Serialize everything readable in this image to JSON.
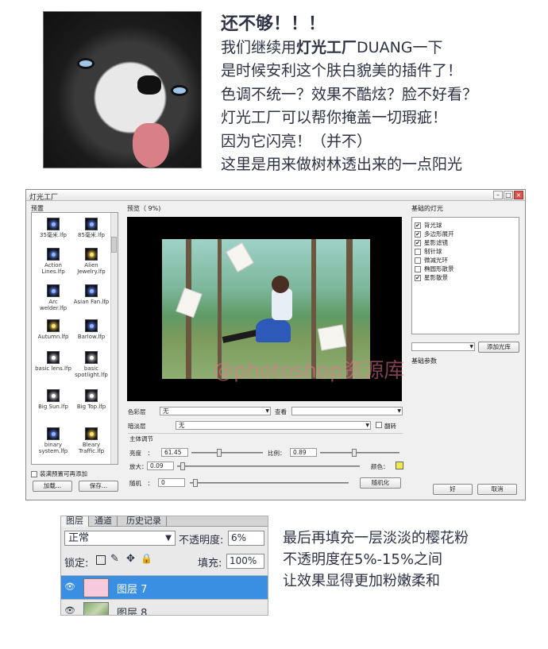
{
  "intro": {
    "title": "还不够！！！",
    "line1_prefix": "我们继续用",
    "line1_bold": "灯光工厂",
    "line1_suffix": "DUANG一下",
    "line2": "是时候安利这个肤白貌美的插件了！",
    "line3": "色调不统一？效果不酷炫？脸不好看？",
    "line4": "灯光工厂可以帮你掩盖一切瑕疵！",
    "line5": "因为它闪亮！（并不）",
    "line6": "这里是用来做树林透出来的一点阳光"
  },
  "dialog": {
    "window_title": "灯光工厂",
    "presets_label": "预置",
    "preview_label": "预览（ 9%)",
    "lights_label": "基础的灯光",
    "presets": [
      {
        "label": "35毫米.lfp",
        "icon": "lens-flare-icon"
      },
      {
        "label": "85毫米.lfp",
        "icon": "lens-flare-icon"
      },
      {
        "label": "Action Lines.lfp",
        "icon": "lens-flare-icon"
      },
      {
        "label": "Alien Jewelry.lfp",
        "icon": "lens-flare-icon"
      },
      {
        "label": "Arc welder.lfp",
        "icon": "lens-flare-icon"
      },
      {
        "label": "Asian Fan.lfp",
        "icon": "lens-flare-icon"
      },
      {
        "label": "Autumn.lfp",
        "icon": "lens-flare-icon"
      },
      {
        "label": "Barlow.lfp",
        "icon": "lens-flare-icon"
      },
      {
        "label": "basic lens.lfp",
        "icon": "lens-flare-icon"
      },
      {
        "label": "basic spotlight.lfp",
        "icon": "lens-flare-icon"
      },
      {
        "label": "Big Sun.lfp",
        "icon": "lens-flare-icon"
      },
      {
        "label": "Big Top.lfp",
        "icon": "lens-flare-icon"
      },
      {
        "label": "binary system.lfp",
        "icon": "lens-flare-icon"
      },
      {
        "label": "Bleary Traffic.lfp",
        "icon": "lens-flare-icon"
      }
    ],
    "auto_add_label": "装满预置可再添加",
    "load_button": "加载...",
    "save_button": "保存...",
    "lights": [
      {
        "label": "背光球",
        "checked": true
      },
      {
        "label": "多边形展开",
        "checked": true
      },
      {
        "label": "星影滤镜",
        "checked": true
      },
      {
        "label": "制针球",
        "checked": false
      },
      {
        "label": "微减光环",
        "checked": false
      },
      {
        "label": "椭圆形散景",
        "checked": false
      },
      {
        "label": "星影散景",
        "checked": true
      }
    ],
    "add_light_button": "添加光库",
    "basic_params_label": "基础参数",
    "color_layer_label": "色彩层",
    "color_layer_value": "无",
    "view_label": "查看",
    "mask_layer_label": "暗淡层",
    "mask_layer_value": "无",
    "invert_label": "翻转",
    "main_adjust_label": "主体调节",
    "brightness_label": "亮度",
    "brightness_value": "61.45",
    "scale_label": "比例：",
    "scale_value": "0.89",
    "zoom_label": "放大：",
    "zoom_value": "0.09",
    "color_label": "颜色：",
    "random_label": "随机",
    "random_value": "0",
    "randomize_button": "随机化",
    "ok_button": "好",
    "cancel_button": "取消",
    "watermark": "@photoshop资源库",
    "colors": {
      "swatch": "#f2e94a"
    }
  },
  "layers": {
    "tabs": [
      "图层",
      "通道",
      "历史记录"
    ],
    "blend_mode": "正常",
    "opacity_label": "不透明度:",
    "opacity_value": "6%",
    "lock_label": "锁定:",
    "fill_label": "填充:",
    "fill_value": "100%",
    "rows": [
      {
        "name": "图层 7",
        "selected": true,
        "thumb_color": "#f7c9dc"
      },
      {
        "name": "图层 8",
        "selected": false,
        "thumb_color": "#7fa86a"
      }
    ]
  },
  "outro": {
    "line1": "最后再填充一层淡淡的樱花粉",
    "line2": "不透明度在5%-15%之间",
    "line3": "让效果显得更加粉嫩柔和"
  }
}
